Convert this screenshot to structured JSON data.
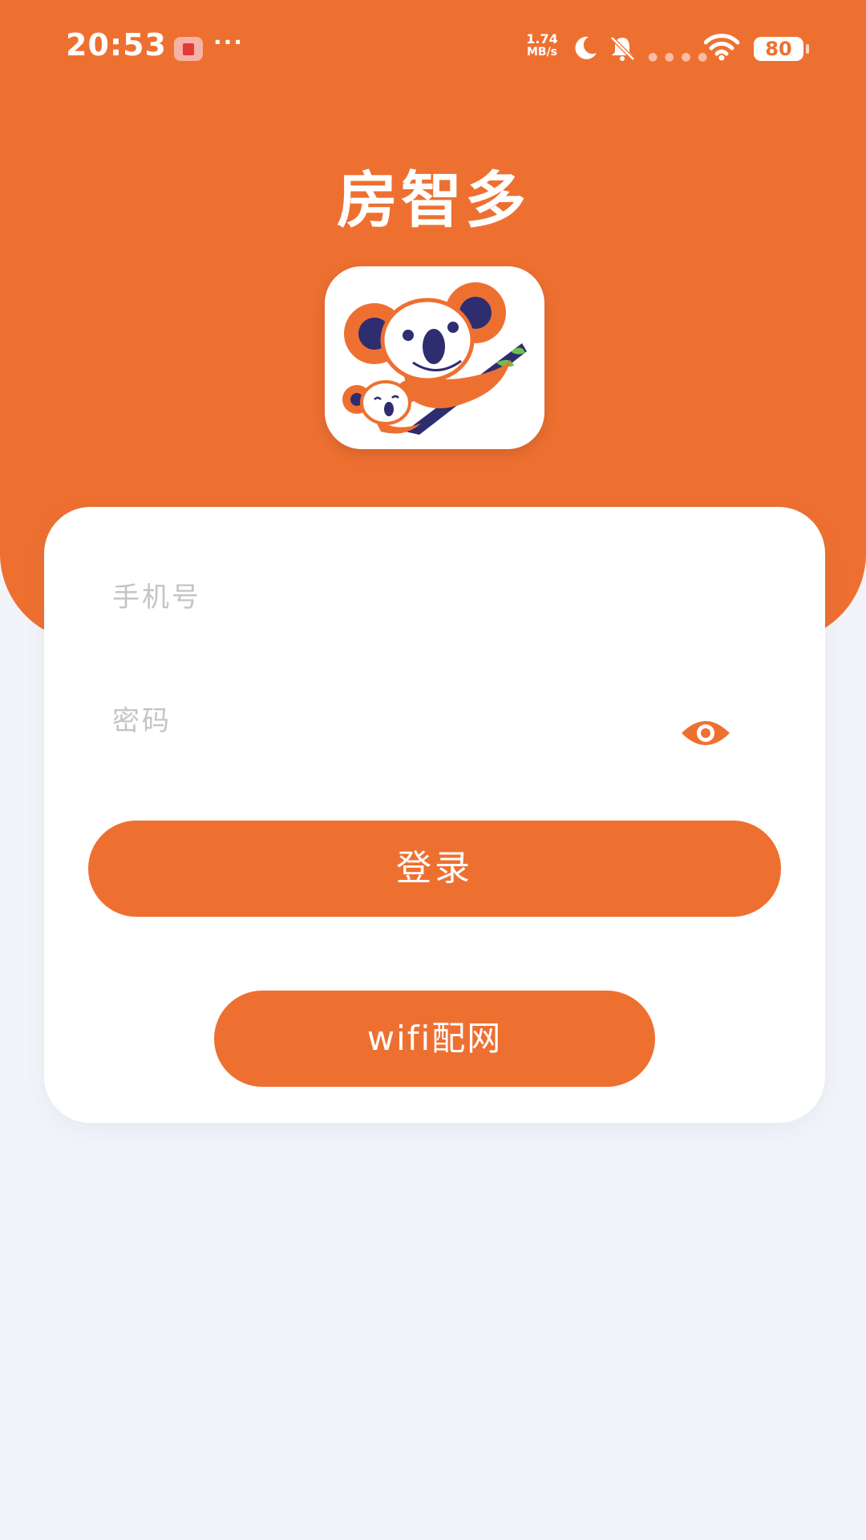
{
  "status_bar": {
    "time": "20:53",
    "more": "···",
    "net_speed_value": "1.74",
    "net_speed_unit": "MB/s",
    "battery": "80"
  },
  "header": {
    "title": "房智多"
  },
  "form": {
    "phone_placeholder": "手机号",
    "password_placeholder": "密码",
    "login_label": "登录",
    "wifi_label": "wifi配网"
  },
  "icons": {
    "logo": "koala-logo-icon",
    "password_toggle": "eye-icon",
    "status": [
      "notification-icon",
      "moon-icon",
      "bell-off-icon",
      "wifi-icon",
      "battery-icon"
    ]
  },
  "colors": {
    "accent": "#ee7031",
    "background": "#f2f4f9",
    "card": "#ffffff",
    "placeholder": "#c4c4c4",
    "logo_navy": "#2d2d70"
  }
}
